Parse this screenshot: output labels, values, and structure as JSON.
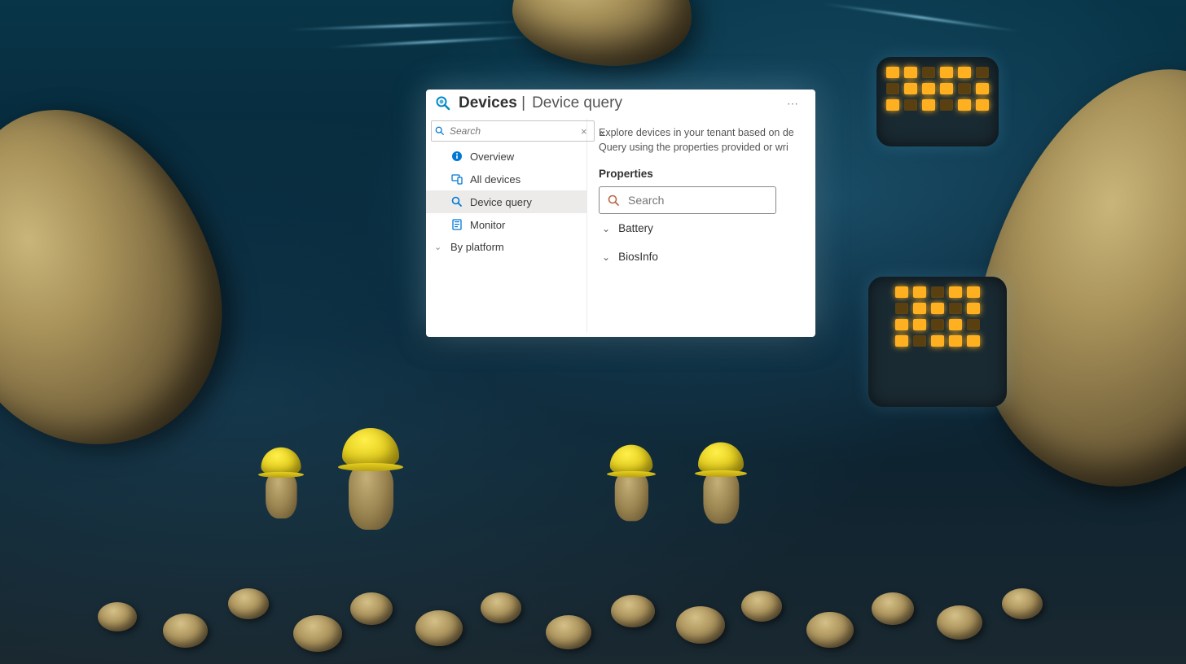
{
  "header": {
    "title_left": "Devices",
    "separator": "|",
    "title_right": "Device query"
  },
  "sidebar": {
    "search_placeholder": "Search",
    "items": [
      {
        "label": "Overview"
      },
      {
        "label": "All devices"
      },
      {
        "label": "Device query"
      },
      {
        "label": "Monitor"
      },
      {
        "label": "By platform"
      }
    ]
  },
  "main": {
    "description_line1": "Explore devices in your tenant based on de",
    "description_line2": "Query using the properties provided or wri",
    "properties_heading": "Properties",
    "properties_search_placeholder": "Search",
    "properties": [
      {
        "label": "Battery"
      },
      {
        "label": "BiosInfo"
      }
    ]
  }
}
